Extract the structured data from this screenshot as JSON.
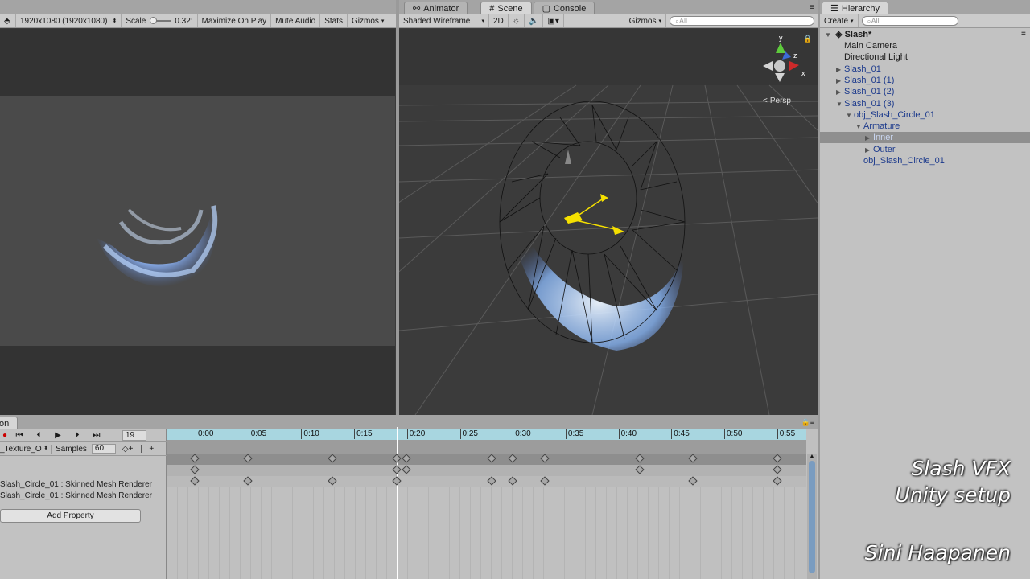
{
  "game_view": {
    "resolution": "1920x1080 (1920x1080)",
    "scale_label": "Scale",
    "scale_value": "0.32:",
    "buttons": [
      "Maximize On Play",
      "Mute Audio",
      "Stats",
      "Gizmos"
    ]
  },
  "scene_view": {
    "tabs": [
      "Animator",
      "Scene",
      "Console"
    ],
    "render_mode": "Shaded Wireframe",
    "mode_2d": "2D",
    "gizmos_label": "Gizmos",
    "search_placeholder": "All",
    "persp_label": "Persp",
    "gizmo_axes": [
      "y",
      "z",
      "x"
    ]
  },
  "hierarchy": {
    "tab_label": "Hierarchy",
    "create_label": "Create",
    "search_placeholder": "All",
    "scene_name": "Slash*",
    "items": [
      {
        "label": "Main Camera",
        "depth": 1,
        "expander": "",
        "color": "black"
      },
      {
        "label": "Directional Light",
        "depth": 1,
        "expander": "",
        "color": "black"
      },
      {
        "label": "Slash_01",
        "depth": 1,
        "expander": "▶",
        "color": "blue"
      },
      {
        "label": "Slash_01 (1)",
        "depth": 1,
        "expander": "▶",
        "color": "blue"
      },
      {
        "label": "Slash_01 (2)",
        "depth": 1,
        "expander": "▶",
        "color": "blue"
      },
      {
        "label": "Slash_01 (3)",
        "depth": 1,
        "expander": "▼",
        "color": "blue"
      },
      {
        "label": "obj_Slash_Circle_01",
        "depth": 2,
        "expander": "▼",
        "color": "blue"
      },
      {
        "label": "Armature",
        "depth": 3,
        "expander": "▼",
        "color": "blue"
      },
      {
        "label": "Inner",
        "depth": 4,
        "expander": "▶",
        "color": "selected"
      },
      {
        "label": "Outer",
        "depth": 4,
        "expander": "▶",
        "color": "blue"
      },
      {
        "label": "obj_Slash_Circle_01",
        "depth": 3,
        "expander": "",
        "color": "blue"
      }
    ]
  },
  "animation": {
    "tab_label": "on",
    "frame": "19",
    "clip_name": "_Texture_O",
    "samples_label": "Samples",
    "samples_value": "60",
    "properties": [
      "Slash_Circle_01 : Skinned Mesh Renderer",
      "Slash_Circle_01 : Skinned Mesh Renderer"
    ],
    "add_property_label": "Add Property",
    "timeline_ticks": [
      "0:00",
      "0:05",
      "0:10",
      "0:15",
      "0:20",
      "0:25",
      "0:30",
      "0:35",
      "0:40",
      "0:45",
      "0:50",
      "0:55"
    ],
    "playhead_time": "0:19"
  },
  "overlay": {
    "title_line1": "Slash VFX",
    "title_line2": "Unity setup",
    "author": "Sini Haapanen"
  },
  "colors": {
    "editor_bg": "#c2c2c2",
    "scene_bg": "#3c3c3c",
    "game_bg": "#4a4a4a",
    "timeline_accent": "#a8d6e0",
    "selection": "#8f8f8f"
  }
}
